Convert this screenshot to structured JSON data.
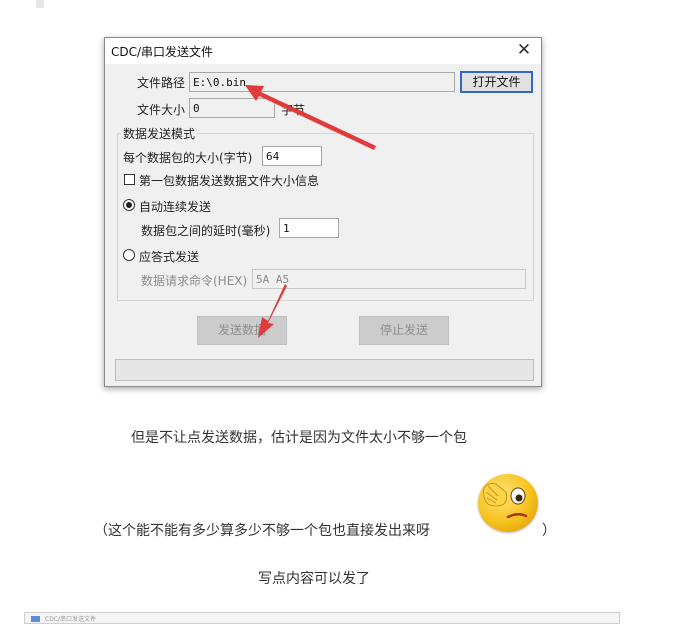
{
  "dialog": {
    "title": "CDC/串口发送文件",
    "file_path_label": "文件路径",
    "file_path_value": "E:\\0.bin",
    "open_file_button": "打开文件",
    "file_size_label": "文件大小",
    "file_size_value": "0",
    "file_size_unit": "字节",
    "mode_group_title": "数据发送模式",
    "packet_size_label": "每个数据包的大小(字节)",
    "packet_size_value": "64",
    "first_packet_checkbox_label": "第一包数据发送数据文件大小信息",
    "first_packet_checked": false,
    "auto_send_label": "自动连续发送",
    "auto_send_selected": true,
    "delay_label": "数据包之间的延时(毫秒)",
    "delay_value": "1",
    "response_send_label": "应答式发送",
    "response_send_selected": false,
    "request_cmd_label": "数据请求命令(HEX)",
    "request_cmd_value": "5A A5",
    "send_button": "发送数据",
    "stop_button": "停止发送",
    "progress_fraction": 0
  },
  "post": {
    "line1": "但是不让点发送数据，估计是因为文件太小不够一个包",
    "line2_open": "（这个能不能有多少算多少不够一个包也直接发出来呀",
    "line2_close": "）",
    "line3": "写点内容可以发了",
    "thumbnail_title": "CDC/串口发送文件"
  },
  "colors": {
    "annotation_arrow": "#e03a3a",
    "focus_border": "#2f6ac4",
    "emoji_yellow": "#f6c21c"
  },
  "icons": {
    "close": "close-icon",
    "emoji": "covering-eye-emoji"
  }
}
